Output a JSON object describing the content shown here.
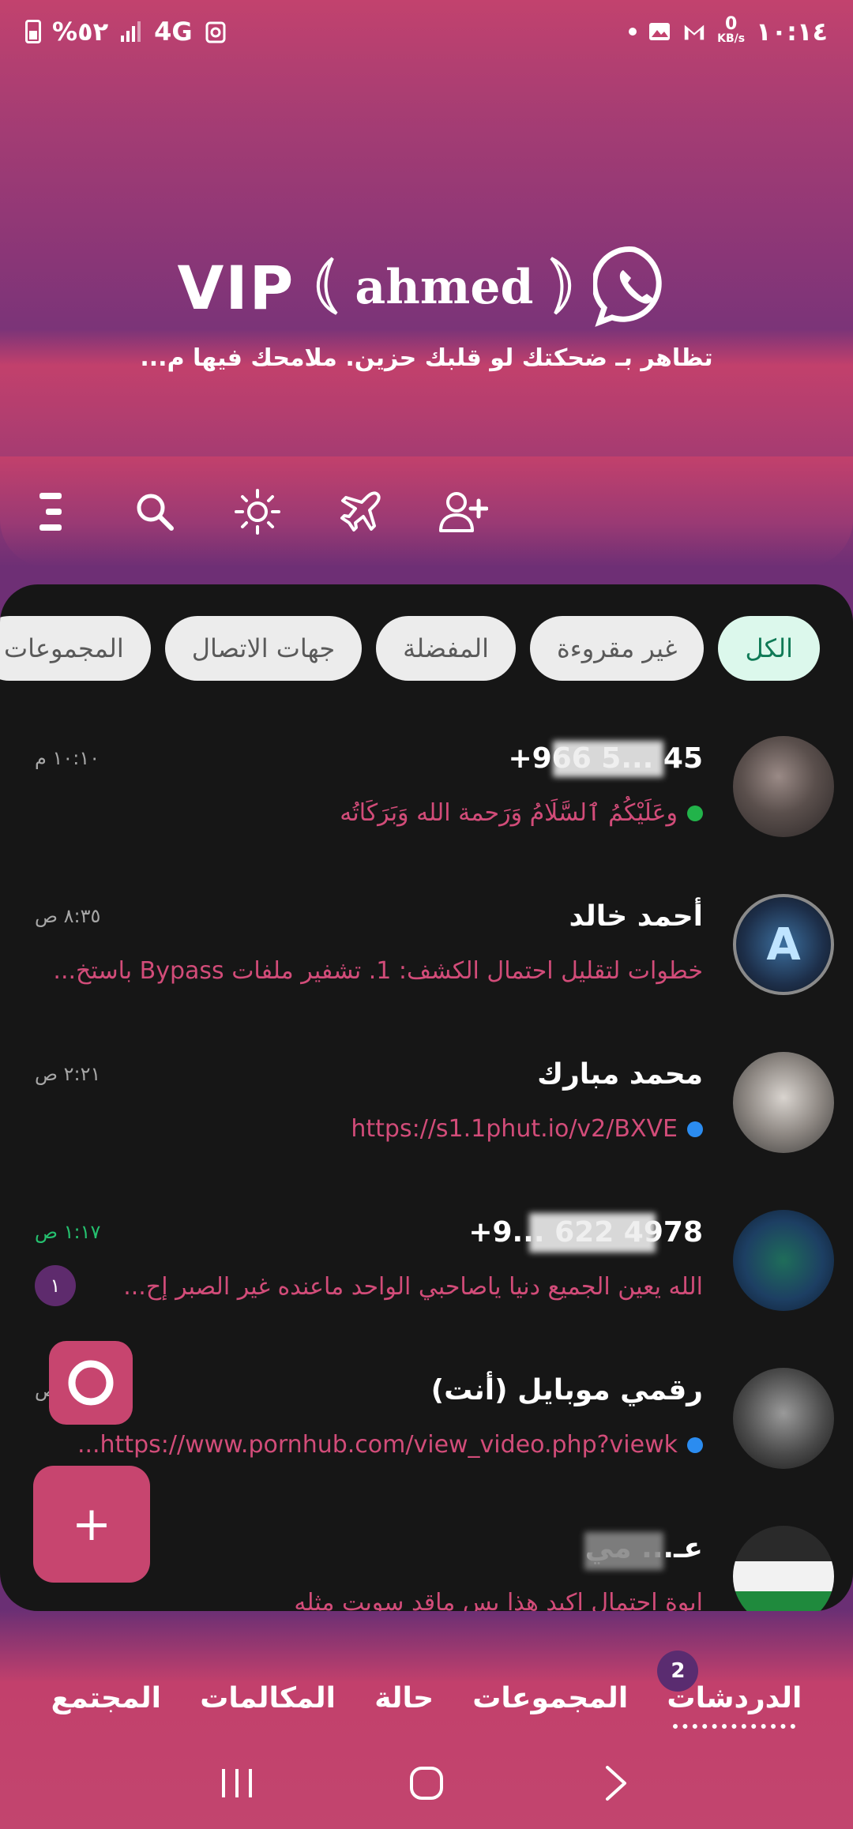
{
  "status_bar": {
    "battery": "%٥٢",
    "network": "4G",
    "time": "١٠:١٤",
    "speed_value": "0",
    "speed_unit": "KB/s"
  },
  "header": {
    "brand_vip": "VIP",
    "brand_name": "ahmed",
    "tagline": "تظاهر بـ ضحكتك لو قلبك حزين. ملامحك فيها م..."
  },
  "toolbar": {
    "icons": [
      "menu-icon",
      "search-icon",
      "brightness-icon",
      "airplane-icon",
      "add-contact-icon"
    ]
  },
  "chips": [
    "الكل",
    "غير مقروءة",
    "المفضلة",
    "جهات الاتصال",
    "المجموعات"
  ],
  "chats": [
    {
      "name": "+966 5... 45",
      "time": "١٠:١٠ م",
      "message": "وعَلَيْكُمُ ٱلسَّلَامُ وَرَحمة الله وَبَرَكَاتُه",
      "dot_color": "#22b34a"
    },
    {
      "name": "أحمد خالد",
      "time": "٨:٣٥ ص",
      "message": "خطوات لتقليل احتمال الكشف: 1. تشفير ملفات Bypass باستخ..."
    },
    {
      "name": "محمد مبارك",
      "time": "٢:٢١ ص",
      "message": "https://s1.1phut.io/v2/BXVE",
      "dot_color": "#2b8cf0"
    },
    {
      "name": "+9... 622 4978",
      "time": "١:١٧ ص",
      "time_color": "#25c16f",
      "message": "الله يعين الجميع دنيا ياصاحبي الواحد ماعنده غير الصبر إح...",
      "unread": "١"
    },
    {
      "name": "رقمي موبايل (أنت)",
      "time": "ص",
      "message": "https://www.pornhub.com/view_video.php?viewk...",
      "dot_color": "#2b8cf0"
    },
    {
      "name": "عـ... مي",
      "time": "",
      "message": "ابوة احتمال اكيد هذا بس ماقد سويت مثله"
    }
  ],
  "fab": {
    "add_label": "+"
  },
  "bottom_nav": {
    "items": [
      "الدردشات",
      "المجموعات",
      "حالة",
      "المكالمات",
      "المجتمع"
    ],
    "badge": "2"
  },
  "colors": {
    "accent": "#c7456f",
    "panel": "#161616",
    "message": "#d24c79"
  }
}
